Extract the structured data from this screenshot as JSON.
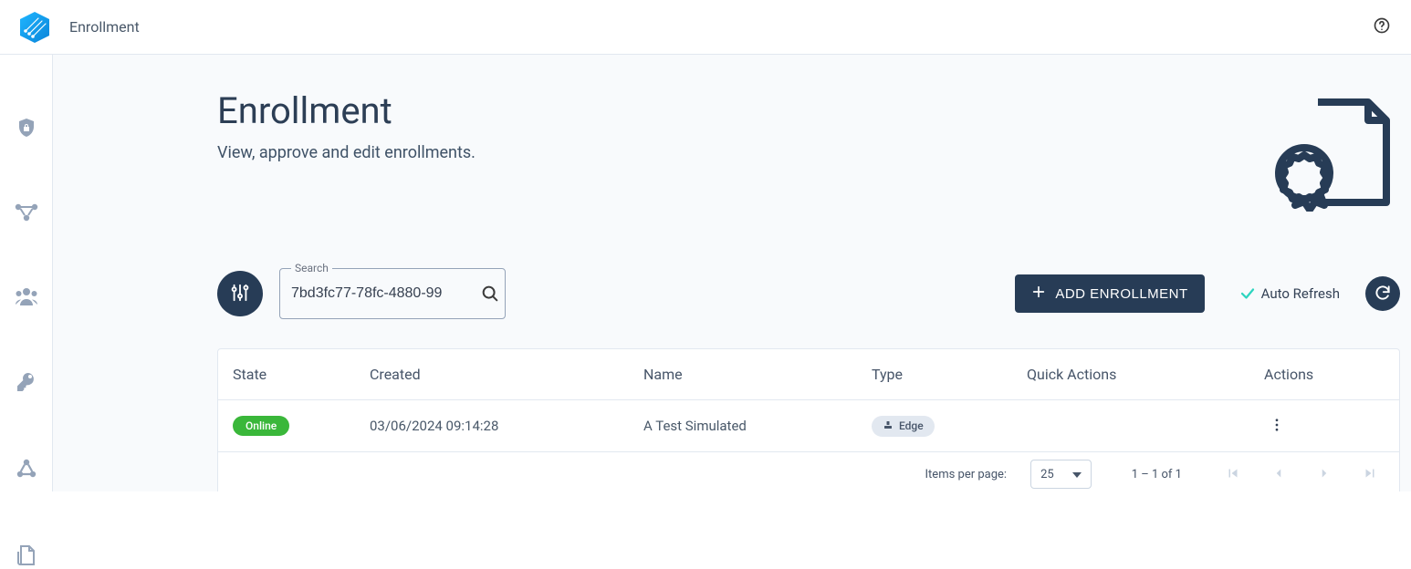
{
  "header": {
    "app_title": "Enrollment"
  },
  "page": {
    "title": "Enrollment",
    "subtitle": "View, approve and edit enrollments."
  },
  "toolbar": {
    "search_label": "Search",
    "search_value": "7bd3fc77-78fc-4880-99",
    "add_label": "ADD ENROLLMENT",
    "auto_refresh_label": "Auto Refresh"
  },
  "table": {
    "columns": {
      "state": "State",
      "created": "Created",
      "name": "Name",
      "type": "Type",
      "quick_actions": "Quick Actions",
      "actions": "Actions"
    },
    "rows": [
      {
        "state": "Online",
        "created": "03/06/2024 09:14:28",
        "name": "A Test Simulated",
        "type": "Edge"
      }
    ]
  },
  "paginator": {
    "items_per_page_label": "Items per page:",
    "page_size": "25",
    "range_label": "1 – 1 of 1"
  }
}
